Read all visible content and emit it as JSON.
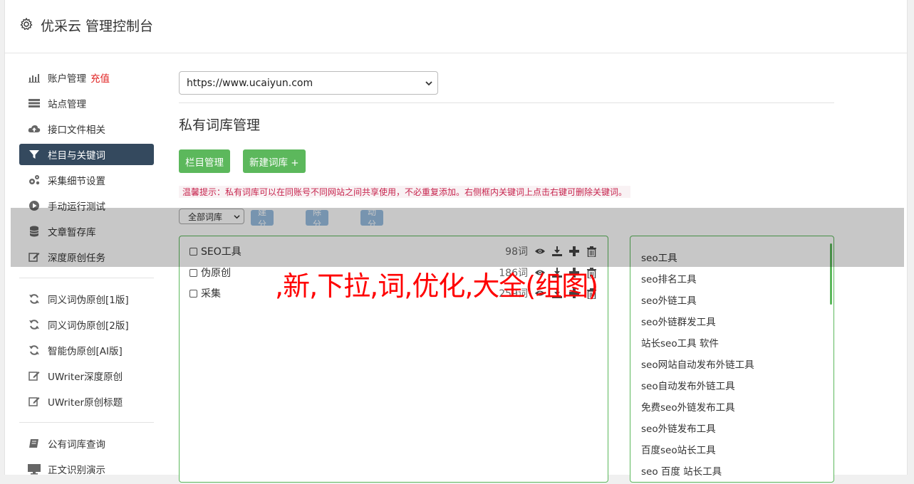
{
  "header": {
    "title": "优采云 管理控制台",
    "icon": "gear-icon"
  },
  "sidebar": {
    "group1": [
      {
        "label": "账户管理",
        "badge": "充值",
        "icon": "bar-chart-icon"
      },
      {
        "label": "站点管理",
        "icon": "server-icon"
      },
      {
        "label": "接口文件相关",
        "icon": "cloud-upload-icon"
      },
      {
        "label": "栏目与关键词",
        "icon": "filter-icon",
        "active": true
      },
      {
        "label": "采集细节设置",
        "icon": "cogs-icon"
      },
      {
        "label": "手动运行测试",
        "icon": "play-circle-icon"
      },
      {
        "label": "文章暂存库",
        "icon": "database-icon"
      },
      {
        "label": "深度原创任务",
        "icon": "edit-icon"
      }
    ],
    "group2": [
      {
        "label": "同义词伪原创[1版]",
        "icon": "refresh-icon"
      },
      {
        "label": "同义词伪原创[2版]",
        "icon": "refresh-icon"
      },
      {
        "label": "智能伪原创[AI版]",
        "icon": "refresh-icon"
      },
      {
        "label": "UWriter深度原创",
        "icon": "edit-icon"
      },
      {
        "label": "UWriter原创标题",
        "icon": "edit-icon"
      }
    ],
    "group3": [
      {
        "label": "公有词库查询",
        "icon": "book-icon"
      },
      {
        "label": "正文识别演示",
        "icon": "monitor-icon"
      }
    ]
  },
  "site_select": {
    "value": "https://www.ucaiyun.com"
  },
  "page_title": "私有词库管理",
  "buttons": {
    "column_manage": "栏目管理",
    "new_library": "新建词库 +"
  },
  "tip": "温馨提示：私有词库可以在同账号不同网站之间共享使用，不必重复添加。右侧框内关键词上点击右键可删除关键词。",
  "toolbar": {
    "filter_value": "全部词库",
    "new_group": "新建分组",
    "delete_group": "删除分组",
    "move_group": "移动分组"
  },
  "libraries": [
    {
      "name": "SEO工具",
      "count": "98词"
    },
    {
      "name": "伪原创",
      "count": "186词"
    },
    {
      "name": "采集",
      "count": "259词"
    }
  ],
  "keywords": [
    "seo工具",
    "seo排名工具",
    "seo外链工具",
    "seo外链群发工具",
    "站长seo工具 软件",
    "seo网站自动发布外链工具",
    "seo自动发布外链工具",
    "免费seo外链发布工具",
    "seo外链发布工具",
    "百度seo站长工具",
    "seo 百度 站长工具"
  ],
  "watermark": ",新,下拉,词,优化,大全(组图)",
  "colors": {
    "green": "#5cb85c",
    "active_nav": "#34495e",
    "badge_red": "#e02020",
    "tip_red": "#c7254e",
    "watermark": "#ff0000"
  }
}
